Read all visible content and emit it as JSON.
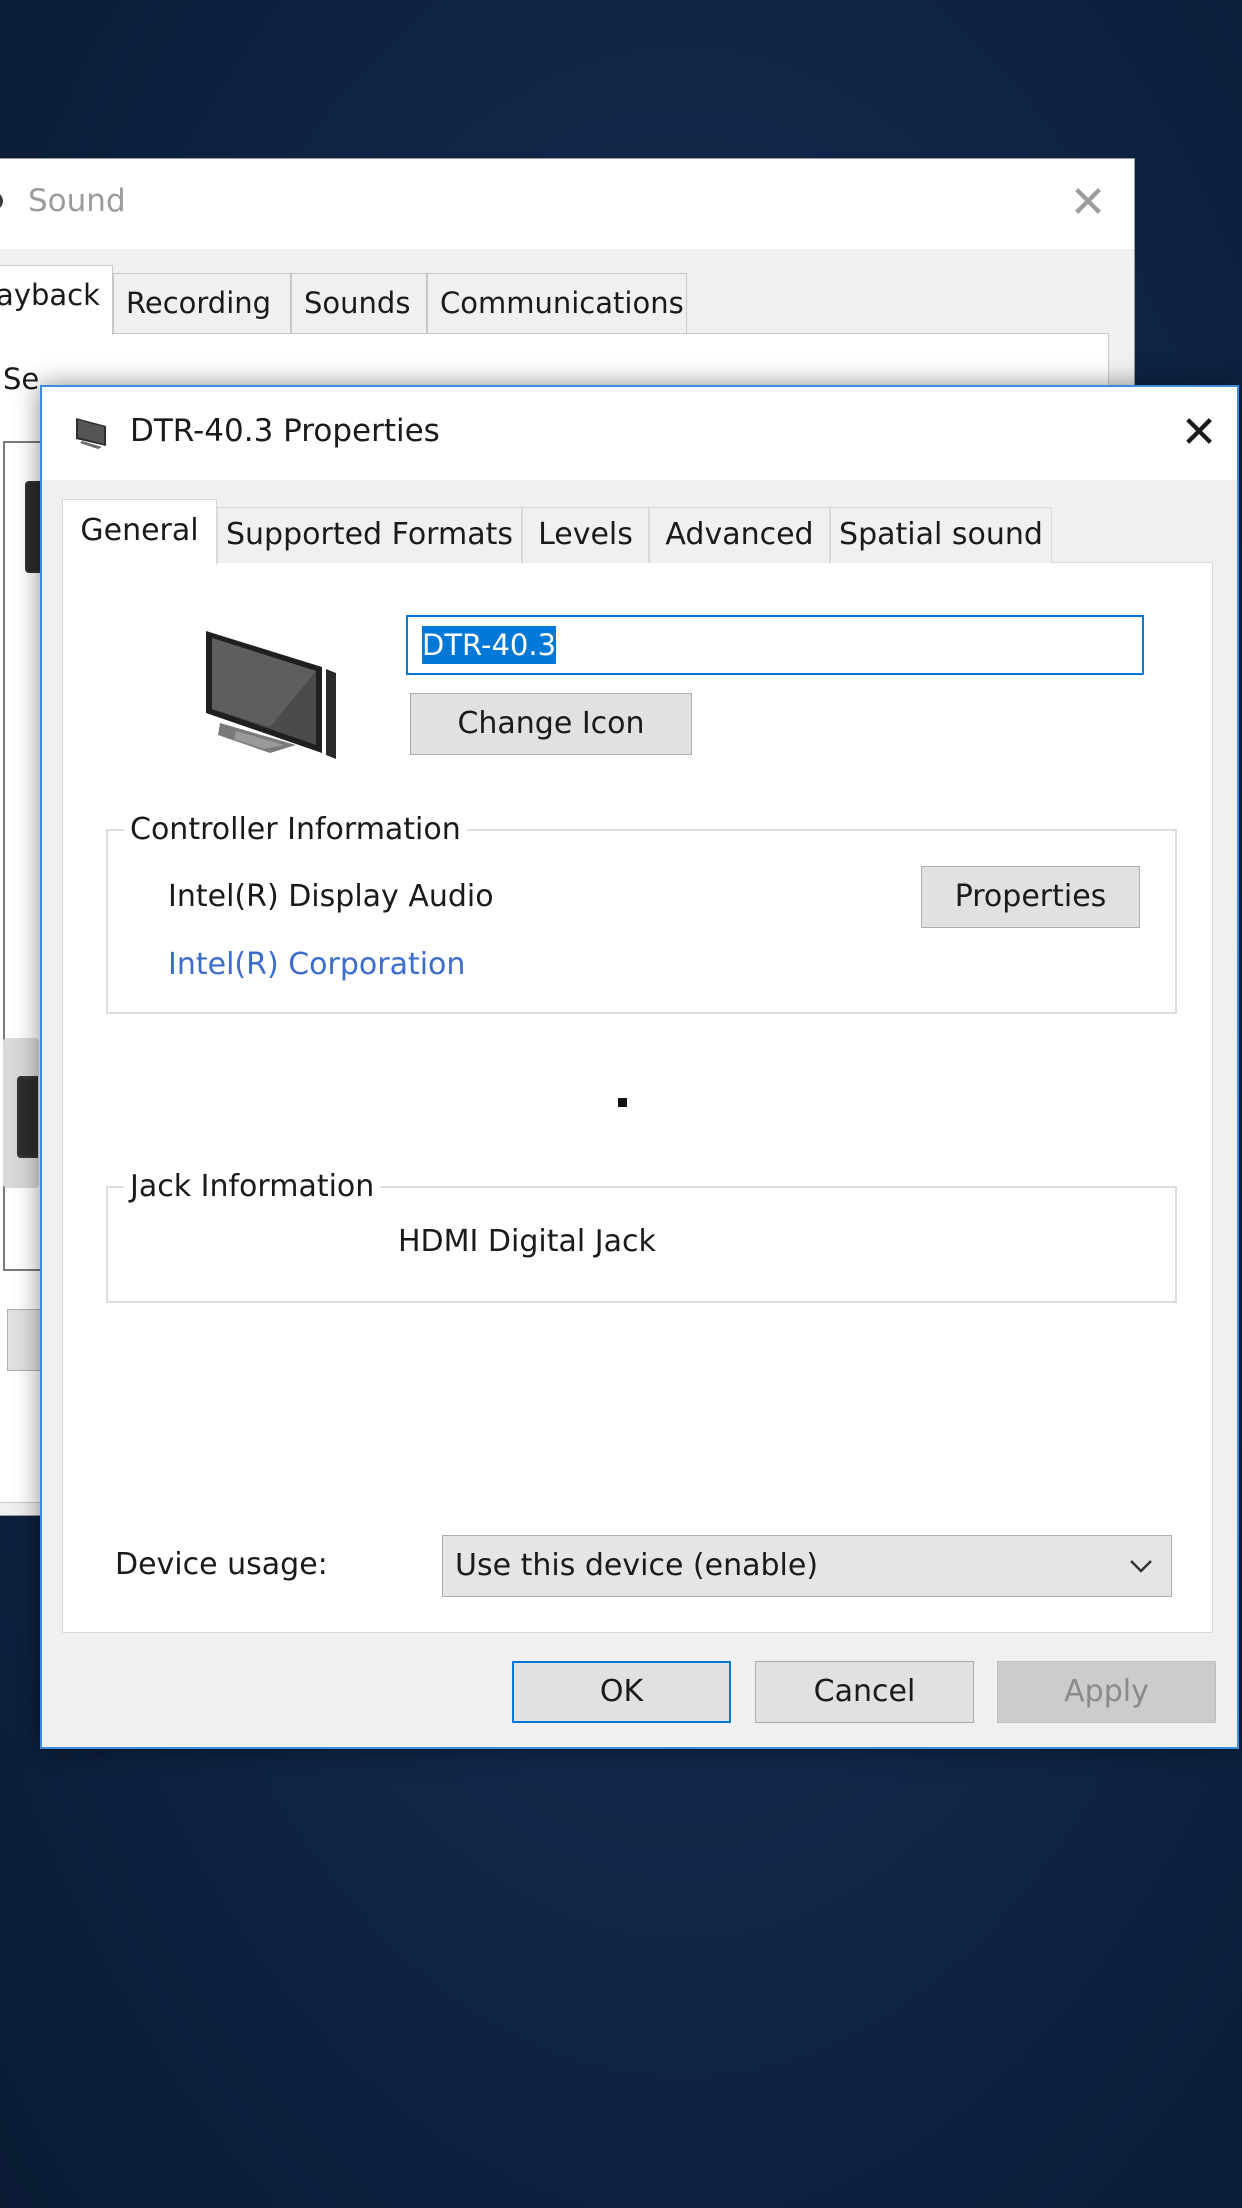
{
  "sound_window": {
    "title": "Sound",
    "close_glyph": "✕",
    "tabs": [
      {
        "label": "layback"
      },
      {
        "label": "Recording"
      },
      {
        "label": "Sounds"
      },
      {
        "label": "Communications"
      }
    ],
    "description_fragment": "Se"
  },
  "dialog": {
    "title": "DTR-40.3 Properties",
    "close_glyph": "✕",
    "tabs": [
      {
        "label": "General"
      },
      {
        "label": "Supported Formats"
      },
      {
        "label": "Levels"
      },
      {
        "label": "Advanced"
      },
      {
        "label": "Spatial sound"
      }
    ],
    "device_name": "DTR-40.3",
    "change_icon_label": "Change Icon",
    "controller": {
      "legend": "Controller Information",
      "name": "Intel(R) Display Audio",
      "vendor": "Intel(R) Corporation",
      "properties_label": "Properties"
    },
    "jack": {
      "legend": "Jack Information",
      "text": "HDMI Digital Jack"
    },
    "device_usage": {
      "label": "Device usage:",
      "selected": "Use this device (enable)"
    },
    "buttons": {
      "ok": "OK",
      "cancel": "Cancel",
      "apply": "Apply"
    }
  },
  "colors": {
    "accent": "#0078d7",
    "link": "#3c6ccc",
    "dialog_border": "#3c8ce0"
  },
  "icons": [
    "sound-icon",
    "speaker-monitor-icon",
    "monitor-icon",
    "close-icon",
    "chevron-down-icon"
  ]
}
